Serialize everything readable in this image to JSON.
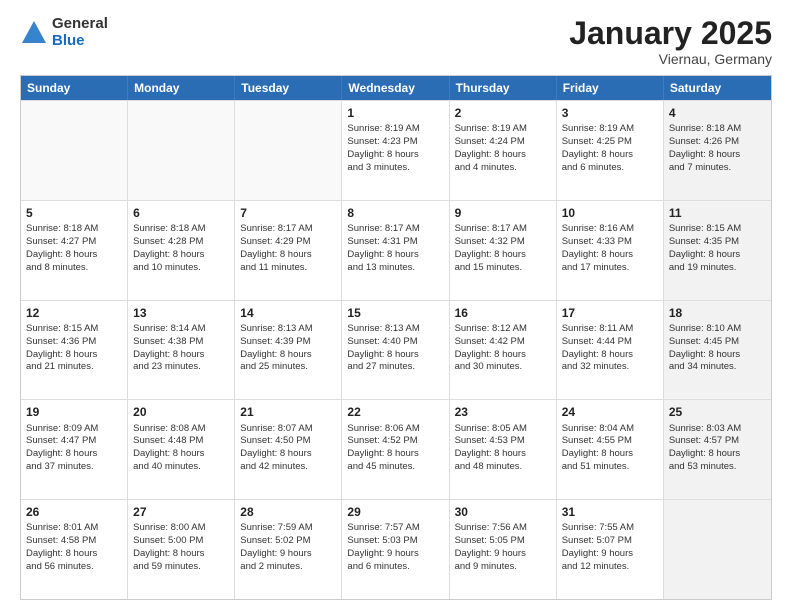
{
  "logo": {
    "general": "General",
    "blue": "Blue"
  },
  "header": {
    "month": "January 2025",
    "location": "Viernau, Germany"
  },
  "weekdays": [
    "Sunday",
    "Monday",
    "Tuesday",
    "Wednesday",
    "Thursday",
    "Friday",
    "Saturday"
  ],
  "rows": [
    [
      {
        "day": "",
        "text": "",
        "empty": true
      },
      {
        "day": "",
        "text": "",
        "empty": true
      },
      {
        "day": "",
        "text": "",
        "empty": true
      },
      {
        "day": "1",
        "text": "Sunrise: 8:19 AM\nSunset: 4:23 PM\nDaylight: 8 hours\nand 3 minutes.",
        "empty": false
      },
      {
        "day": "2",
        "text": "Sunrise: 8:19 AM\nSunset: 4:24 PM\nDaylight: 8 hours\nand 4 minutes.",
        "empty": false
      },
      {
        "day": "3",
        "text": "Sunrise: 8:19 AM\nSunset: 4:25 PM\nDaylight: 8 hours\nand 6 minutes.",
        "empty": false
      },
      {
        "day": "4",
        "text": "Sunrise: 8:18 AM\nSunset: 4:26 PM\nDaylight: 8 hours\nand 7 minutes.",
        "empty": false,
        "shaded": true
      }
    ],
    [
      {
        "day": "5",
        "text": "Sunrise: 8:18 AM\nSunset: 4:27 PM\nDaylight: 8 hours\nand 8 minutes.",
        "empty": false
      },
      {
        "day": "6",
        "text": "Sunrise: 8:18 AM\nSunset: 4:28 PM\nDaylight: 8 hours\nand 10 minutes.",
        "empty": false
      },
      {
        "day": "7",
        "text": "Sunrise: 8:17 AM\nSunset: 4:29 PM\nDaylight: 8 hours\nand 11 minutes.",
        "empty": false
      },
      {
        "day": "8",
        "text": "Sunrise: 8:17 AM\nSunset: 4:31 PM\nDaylight: 8 hours\nand 13 minutes.",
        "empty": false
      },
      {
        "day": "9",
        "text": "Sunrise: 8:17 AM\nSunset: 4:32 PM\nDaylight: 8 hours\nand 15 minutes.",
        "empty": false
      },
      {
        "day": "10",
        "text": "Sunrise: 8:16 AM\nSunset: 4:33 PM\nDaylight: 8 hours\nand 17 minutes.",
        "empty": false
      },
      {
        "day": "11",
        "text": "Sunrise: 8:15 AM\nSunset: 4:35 PM\nDaylight: 8 hours\nand 19 minutes.",
        "empty": false,
        "shaded": true
      }
    ],
    [
      {
        "day": "12",
        "text": "Sunrise: 8:15 AM\nSunset: 4:36 PM\nDaylight: 8 hours\nand 21 minutes.",
        "empty": false
      },
      {
        "day": "13",
        "text": "Sunrise: 8:14 AM\nSunset: 4:38 PM\nDaylight: 8 hours\nand 23 minutes.",
        "empty": false
      },
      {
        "day": "14",
        "text": "Sunrise: 8:13 AM\nSunset: 4:39 PM\nDaylight: 8 hours\nand 25 minutes.",
        "empty": false
      },
      {
        "day": "15",
        "text": "Sunrise: 8:13 AM\nSunset: 4:40 PM\nDaylight: 8 hours\nand 27 minutes.",
        "empty": false
      },
      {
        "day": "16",
        "text": "Sunrise: 8:12 AM\nSunset: 4:42 PM\nDaylight: 8 hours\nand 30 minutes.",
        "empty": false
      },
      {
        "day": "17",
        "text": "Sunrise: 8:11 AM\nSunset: 4:44 PM\nDaylight: 8 hours\nand 32 minutes.",
        "empty": false
      },
      {
        "day": "18",
        "text": "Sunrise: 8:10 AM\nSunset: 4:45 PM\nDaylight: 8 hours\nand 34 minutes.",
        "empty": false,
        "shaded": true
      }
    ],
    [
      {
        "day": "19",
        "text": "Sunrise: 8:09 AM\nSunset: 4:47 PM\nDaylight: 8 hours\nand 37 minutes.",
        "empty": false
      },
      {
        "day": "20",
        "text": "Sunrise: 8:08 AM\nSunset: 4:48 PM\nDaylight: 8 hours\nand 40 minutes.",
        "empty": false
      },
      {
        "day": "21",
        "text": "Sunrise: 8:07 AM\nSunset: 4:50 PM\nDaylight: 8 hours\nand 42 minutes.",
        "empty": false
      },
      {
        "day": "22",
        "text": "Sunrise: 8:06 AM\nSunset: 4:52 PM\nDaylight: 8 hours\nand 45 minutes.",
        "empty": false
      },
      {
        "day": "23",
        "text": "Sunrise: 8:05 AM\nSunset: 4:53 PM\nDaylight: 8 hours\nand 48 minutes.",
        "empty": false
      },
      {
        "day": "24",
        "text": "Sunrise: 8:04 AM\nSunset: 4:55 PM\nDaylight: 8 hours\nand 51 minutes.",
        "empty": false
      },
      {
        "day": "25",
        "text": "Sunrise: 8:03 AM\nSunset: 4:57 PM\nDaylight: 8 hours\nand 53 minutes.",
        "empty": false,
        "shaded": true
      }
    ],
    [
      {
        "day": "26",
        "text": "Sunrise: 8:01 AM\nSunset: 4:58 PM\nDaylight: 8 hours\nand 56 minutes.",
        "empty": false
      },
      {
        "day": "27",
        "text": "Sunrise: 8:00 AM\nSunset: 5:00 PM\nDaylight: 8 hours\nand 59 minutes.",
        "empty": false
      },
      {
        "day": "28",
        "text": "Sunrise: 7:59 AM\nSunset: 5:02 PM\nDaylight: 9 hours\nand 2 minutes.",
        "empty": false
      },
      {
        "day": "29",
        "text": "Sunrise: 7:57 AM\nSunset: 5:03 PM\nDaylight: 9 hours\nand 6 minutes.",
        "empty": false
      },
      {
        "day": "30",
        "text": "Sunrise: 7:56 AM\nSunset: 5:05 PM\nDaylight: 9 hours\nand 9 minutes.",
        "empty": false
      },
      {
        "day": "31",
        "text": "Sunrise: 7:55 AM\nSunset: 5:07 PM\nDaylight: 9 hours\nand 12 minutes.",
        "empty": false
      },
      {
        "day": "",
        "text": "",
        "empty": true,
        "shaded": true
      }
    ]
  ]
}
